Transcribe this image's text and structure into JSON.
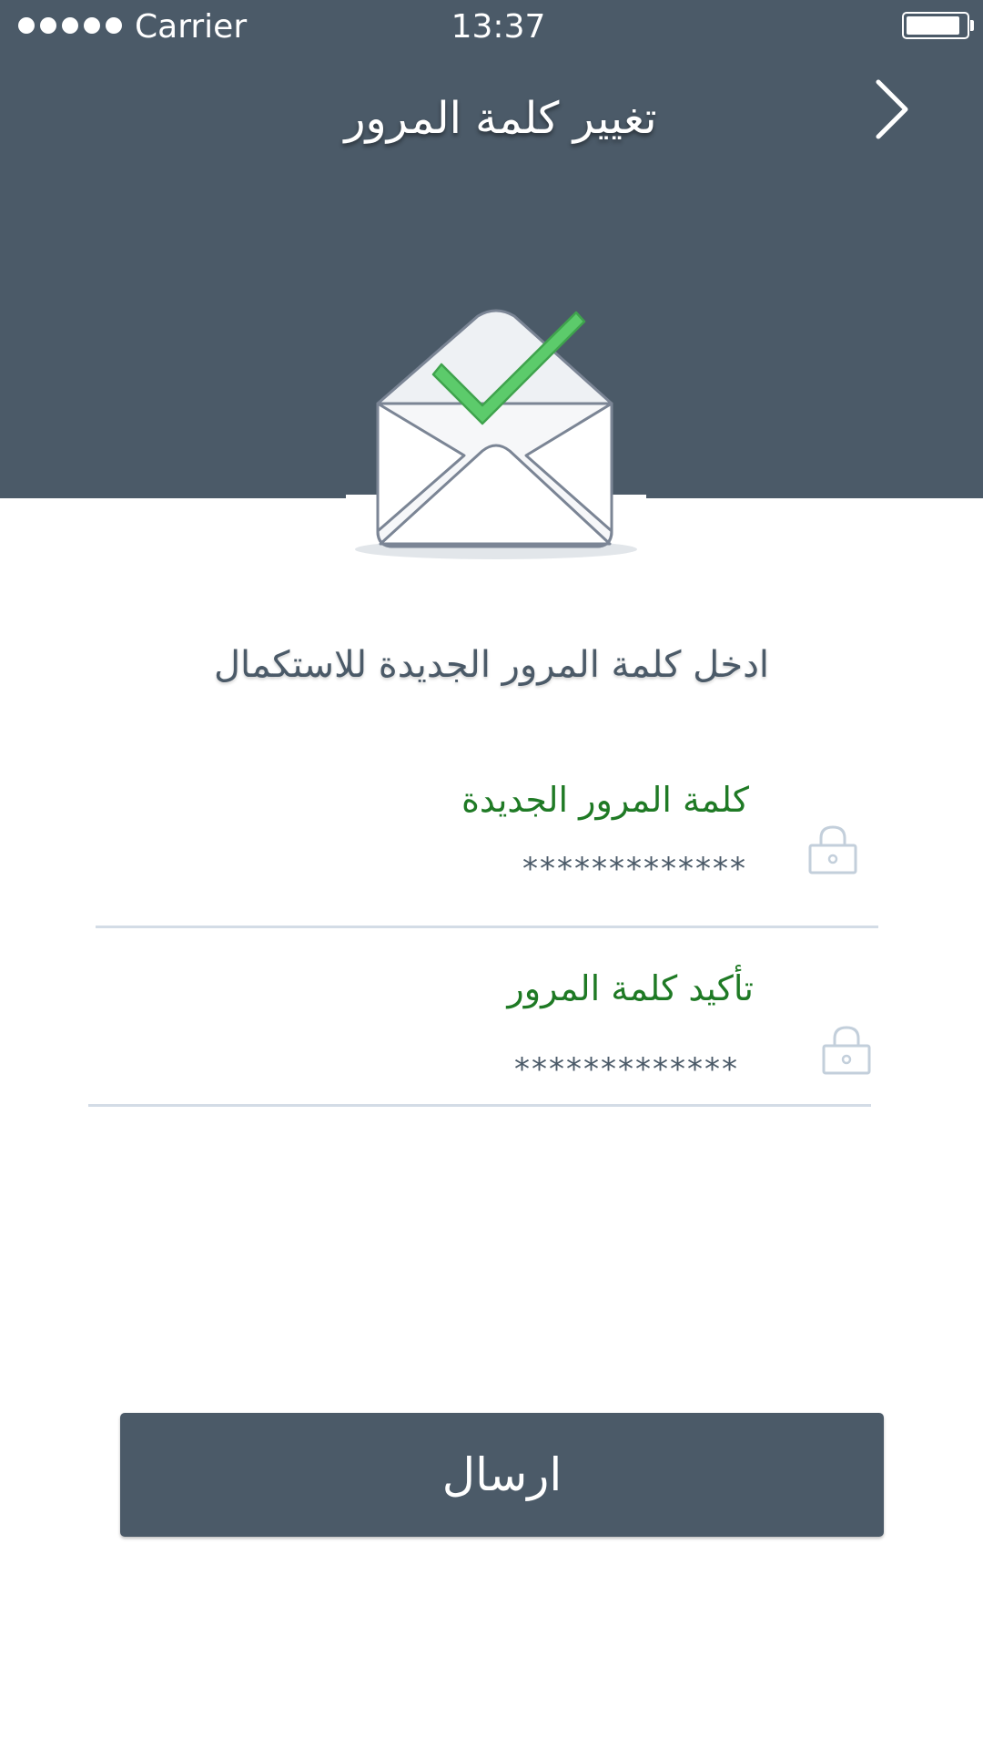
{
  "status_bar": {
    "carrier": "Carrier",
    "time": "13:37",
    "signal_bars": 5,
    "battery_level": 0.9
  },
  "header": {
    "title": "تغيير كلمة المرور",
    "back_icon": "chevron-right-icon"
  },
  "illustration": {
    "icon": "envelope-check-icon",
    "check_color": "#5ccb6b"
  },
  "form": {
    "instruction": "ادخل كلمة المرور الجديدة للاستكمال",
    "new_password": {
      "label": "كلمة المرور الجديدة",
      "value": "*************",
      "icon": "lock-icon"
    },
    "confirm_password": {
      "label": "تأكيد كلمة المرور",
      "value": "*************",
      "icon": "lock-icon"
    }
  },
  "submit": {
    "label": "ارسال"
  },
  "colors": {
    "header_bg": "#4b5a68",
    "label_green": "#1f7a25",
    "divider": "#d3dce6"
  }
}
